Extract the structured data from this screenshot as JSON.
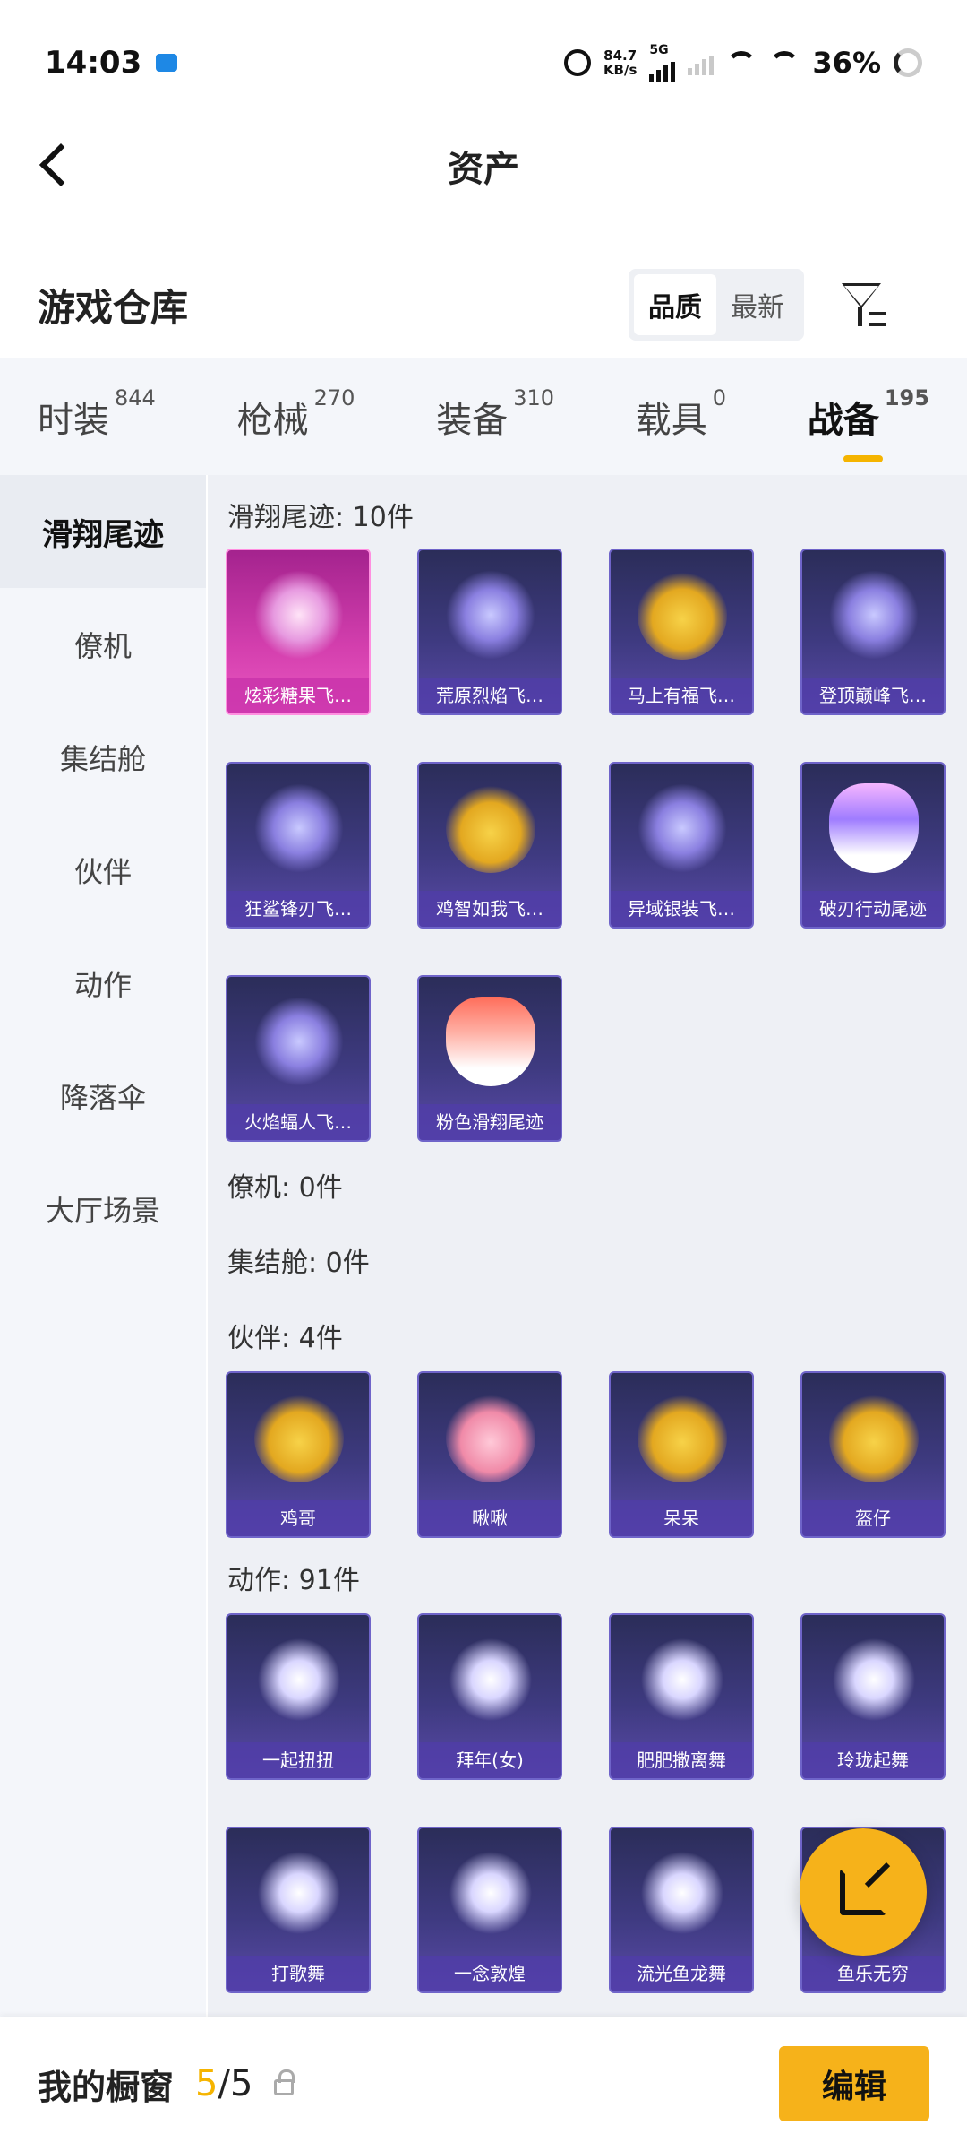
{
  "status_bar": {
    "time": "14:03",
    "net_speed_value": "84.7",
    "net_speed_unit": "KB/s",
    "network_type": "5G",
    "battery": "36%"
  },
  "header": {
    "title": "资产"
  },
  "warehouse": {
    "title": "游戏仓库",
    "sort_options": [
      "品质",
      "最新"
    ],
    "active_sort": "品质"
  },
  "category_tabs": [
    {
      "label": "时装",
      "count": "844"
    },
    {
      "label": "枪械",
      "count": "270"
    },
    {
      "label": "装备",
      "count": "310"
    },
    {
      "label": "载具",
      "count": "0"
    },
    {
      "label": "战备",
      "count": "195",
      "active": true
    }
  ],
  "sidebar": {
    "items": [
      "滑翔尾迹",
      "僚机",
      "集结舱",
      "伙伴",
      "动作",
      "降落伞",
      "大厅场景"
    ],
    "active": "滑翔尾迹"
  },
  "sections": {
    "glide": {
      "title": "滑翔尾迹: 10件",
      "items": [
        "炫彩糖果飞…",
        "荒原烈焰飞…",
        "马上有福飞…",
        "登顶巅峰飞…",
        "狂鲨锋刃飞…",
        "鸡智如我飞…",
        "异域银装飞…",
        "破刃行动尾迹",
        "火焰蝠人飞…",
        "粉色滑翔尾迹"
      ]
    },
    "wingman": {
      "title": "僚机: 0件"
    },
    "pod": {
      "title": "集结舱: 0件"
    },
    "partner": {
      "title": "伙伴: 4件",
      "items": [
        "鸡哥",
        "啾啾",
        "呆呆",
        "盔仔"
      ]
    },
    "emote": {
      "title": "动作: 91件",
      "items": [
        "一起扭扭",
        "拜年(女)",
        "肥肥撒离舞",
        "玲珑起舞",
        "打歌舞",
        "一念敦煌",
        "流光鱼龙舞",
        "鱼乐无穷"
      ]
    }
  },
  "bottom_bar": {
    "label": "我的橱窗",
    "current": "5",
    "separator_total": "/5",
    "edit_label": "编辑"
  },
  "colors": {
    "accent": "#f6b21a",
    "card_purple": "#3e3a80",
    "card_pink": "#d43fae"
  }
}
